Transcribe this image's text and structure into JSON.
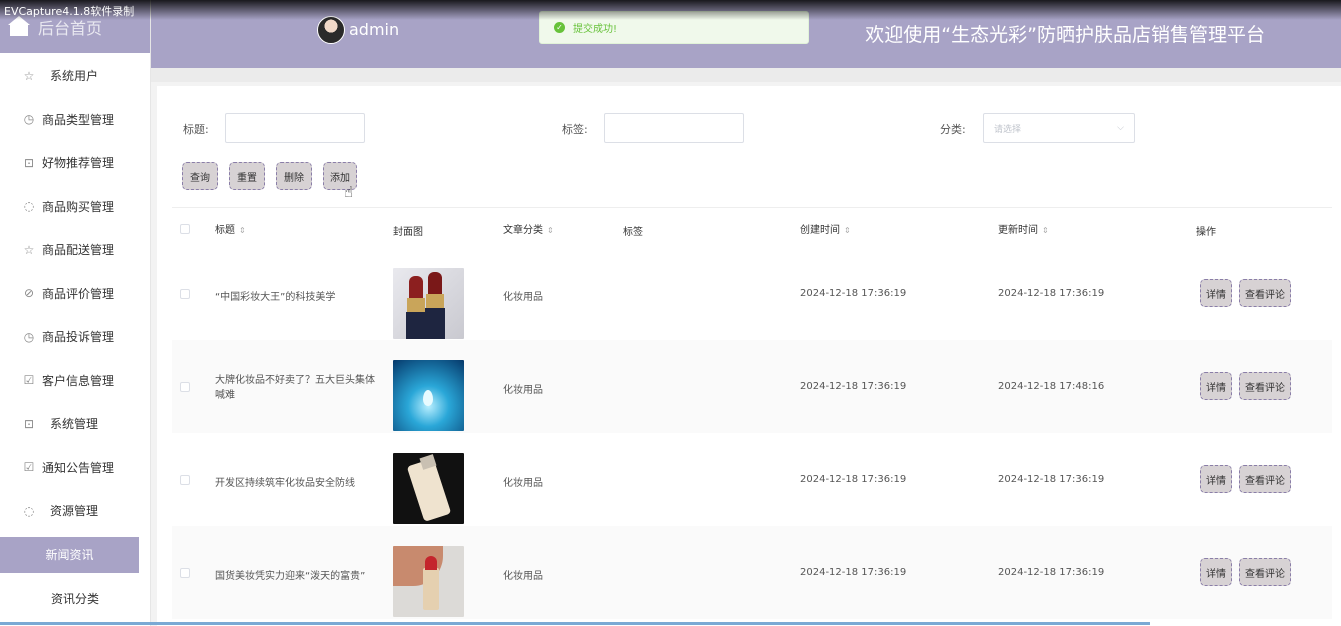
{
  "watermark": "EVCapture4.1.8软件录制",
  "sidebar": {
    "logo_text": "后台首页",
    "items": [
      {
        "label": "系统用户",
        "icon": "star-icon"
      },
      {
        "label": "商品类型管理",
        "icon": "clock-icon"
      },
      {
        "label": "好物推荐管理",
        "icon": "box-icon"
      },
      {
        "label": "商品购买管理",
        "icon": "circle-icon"
      },
      {
        "label": "商品配送管理",
        "icon": "star-icon"
      },
      {
        "label": "商品评价管理",
        "icon": "compass-icon"
      },
      {
        "label": "商品投诉管理",
        "icon": "clock-icon"
      },
      {
        "label": "客户信息管理",
        "icon": "calendar-icon"
      },
      {
        "label": "系统管理",
        "icon": "box-icon"
      },
      {
        "label": "通知公告管理",
        "icon": "calendar-icon"
      },
      {
        "label": "资源管理",
        "icon": "circle-icon"
      },
      {
        "label": "新闻资讯",
        "icon": ""
      },
      {
        "label": "资讯分类",
        "icon": ""
      }
    ]
  },
  "header": {
    "username": "admin",
    "site_title": "欢迎使用“生态光彩”防晒护肤品店销售管理平台"
  },
  "toast": {
    "message": "提交成功!"
  },
  "search": {
    "title_label": "标题:",
    "tag_label": "标签:",
    "category_label": "分类:",
    "category_placeholder": "请选择"
  },
  "actions": {
    "query": "查询",
    "reset": "重置",
    "delete": "删除",
    "add": "添加"
  },
  "table": {
    "headers": {
      "title": "标题",
      "cover": "封面图",
      "category": "文章分类",
      "tags": "标签",
      "created": "创建时间",
      "updated": "更新时间",
      "operation": "操作"
    },
    "row_actions": {
      "detail": "详情",
      "comments": "查看评论"
    },
    "rows": [
      {
        "title": "“中国彩妆大王”的科技美学",
        "category": "化妆用品",
        "created": "2024-12-18 17:36:19",
        "updated": "2024-12-18 17:36:19"
      },
      {
        "title": "大牌化妆品不好卖了？五大巨头集体喊难",
        "category": "化妆用品",
        "created": "2024-12-18 17:36:19",
        "updated": "2024-12-18 17:48:16"
      },
      {
        "title": "开发区持续筑牢化妆品安全防线",
        "category": "化妆用品",
        "created": "2024-12-18 17:36:19",
        "updated": "2024-12-18 17:36:19"
      },
      {
        "title": "国货美妆凭实力迎来“泼天的富贵”",
        "category": "化妆用品",
        "created": "2024-12-18 17:36:19",
        "updated": "2024-12-18 17:36:19"
      }
    ]
  }
}
